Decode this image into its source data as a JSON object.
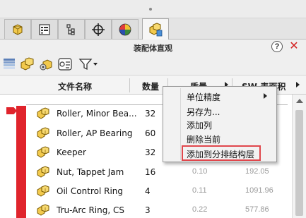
{
  "tabs": [
    {
      "icon": "feature-manager-icon"
    },
    {
      "icon": "property-manager-icon"
    },
    {
      "icon": "configuration-manager-icon"
    },
    {
      "icon": "dimxpert-icon"
    },
    {
      "icon": "display-manager-icon"
    },
    {
      "icon": "assembly-visualization-icon",
      "active": true
    }
  ],
  "header": {
    "title": "装配体直观",
    "help_label": "?",
    "close_label": "✕"
  },
  "toolbar": {
    "tools": [
      "gradient-icon",
      "assembly-icon",
      "assembly-gear-icon",
      "part-list-icon",
      "filter-icon"
    ]
  },
  "columns": {
    "name": "文件名称",
    "qty": "数量",
    "mass": "质量",
    "area": "SW-表面积"
  },
  "rows": [
    {
      "name": "Roller, Minor Bea...",
      "qty": "32",
      "mass": "",
      "area": ""
    },
    {
      "name": "Roller, AP Bearing",
      "qty": "60",
      "mass": "",
      "area": ""
    },
    {
      "name": "Keeper",
      "qty": "32",
      "mass": "",
      "area": ""
    },
    {
      "name": "Nut, Tappet Jam",
      "qty": "16",
      "mass": "0.10",
      "area": "192.05"
    },
    {
      "name": "Oil Control Ring",
      "qty": "4",
      "mass": "0.11",
      "area": "1091.96"
    },
    {
      "name": "Tru-Arc Ring, CS",
      "qty": "3",
      "mass": "0.22",
      "area": "577.86"
    }
  ],
  "context_menu": {
    "items": [
      {
        "label": "单位精度",
        "has_submenu": true
      },
      {
        "label": "另存为..."
      },
      {
        "label": "添加列"
      },
      {
        "label": "删除当前"
      },
      {
        "label": "添加到分排结构层",
        "highlighted": true
      }
    ]
  },
  "colors": {
    "accent_red": "#e0242c",
    "close_red": "#d32020",
    "highlight_border": "#e0474c"
  }
}
